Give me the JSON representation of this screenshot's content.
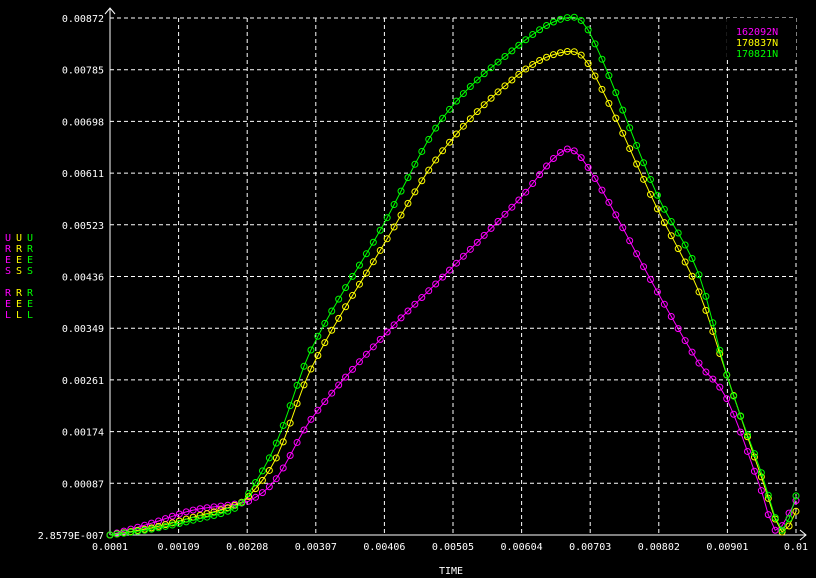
{
  "chart_data": {
    "type": "line",
    "title": "",
    "xlabel": "TIME",
    "ylabel_stack": [
      {
        "text": "URES REL",
        "color": "#ff00ff"
      },
      {
        "text": "URES REL",
        "color": "#ffff00"
      },
      {
        "text": "URES REL",
        "color": "#00ff00"
      }
    ],
    "xlim": [
      0.0001,
      0.01
    ],
    "ylim": [
      2.8579e-07,
      0.00872
    ],
    "x_ticks": [
      "0.0001",
      "0.00109",
      "0.00208",
      "0.00307",
      "0.00406",
      "0.00505",
      "0.00604",
      "0.00703",
      "0.00802",
      "0.00901",
      "0.01"
    ],
    "y_ticks": [
      "2.8579E-007",
      "0.00087",
      "0.00174",
      "0.00261",
      "0.00349",
      "0.00436",
      "0.00523",
      "0.00611",
      "0.00698",
      "0.00785",
      "0.00872"
    ],
    "grid": true,
    "legend_position": "top-right",
    "series": [
      {
        "name": "162092N",
        "color": "#ff00ff",
        "points": [
          [
            0.0001,
            0
          ],
          [
            0.0007,
            0.0002
          ],
          [
            0.0013,
            0.00042
          ],
          [
            0.0019,
            0.00052
          ],
          [
            0.00215,
            0.0006
          ],
          [
            0.0025,
            0.00095
          ],
          [
            0.003,
            0.00195
          ],
          [
            0.004,
            0.0033
          ],
          [
            0.0049,
            0.00435
          ],
          [
            0.006,
            0.00565
          ],
          [
            0.00667,
            0.0065
          ],
          [
            0.007,
            0.0062
          ],
          [
            0.008,
            0.0041
          ],
          [
            0.0086,
            0.0029
          ],
          [
            0.009,
            0.0023
          ],
          [
            0.0095,
            0.00075
          ],
          [
            0.0097,
            8e-05
          ],
          [
            0.01,
            0.00058
          ]
        ]
      },
      {
        "name": "170837N",
        "color": "#ffff00",
        "points": [
          [
            0.0001,
            0
          ],
          [
            0.0007,
            0.00012
          ],
          [
            0.0013,
            0.0003
          ],
          [
            0.0019,
            0.0005
          ],
          [
            0.0021,
            0.00065
          ],
          [
            0.0025,
            0.0013
          ],
          [
            0.003,
            0.0028
          ],
          [
            0.004,
            0.0048
          ],
          [
            0.0049,
            0.00648
          ],
          [
            0.006,
            0.00777
          ],
          [
            0.00667,
            0.00815
          ],
          [
            0.007,
            0.00795
          ],
          [
            0.008,
            0.0055
          ],
          [
            0.0086,
            0.0041
          ],
          [
            0.009,
            0.0027
          ],
          [
            0.0095,
            0.00098
          ],
          [
            0.0098,
            5e-05
          ],
          [
            0.01,
            0.0004
          ]
        ]
      },
      {
        "name": "170821N",
        "color": "#00ff00",
        "points": [
          [
            0.0001,
            0
          ],
          [
            0.0007,
            0.0001
          ],
          [
            0.0013,
            0.00025
          ],
          [
            0.0019,
            0.00045
          ],
          [
            0.0021,
            0.0007
          ],
          [
            0.0025,
            0.00155
          ],
          [
            0.003,
            0.00312
          ],
          [
            0.004,
            0.00514
          ],
          [
            0.0049,
            0.00703
          ],
          [
            0.006,
            0.00826
          ],
          [
            0.00667,
            0.00872
          ],
          [
            0.007,
            0.00852
          ],
          [
            0.008,
            0.00573
          ],
          [
            0.0086,
            0.00439
          ],
          [
            0.009,
            0.0027
          ],
          [
            0.0095,
            0.00105
          ],
          [
            0.0098,
            8e-05
          ],
          [
            0.01,
            0.00066
          ]
        ]
      }
    ]
  }
}
